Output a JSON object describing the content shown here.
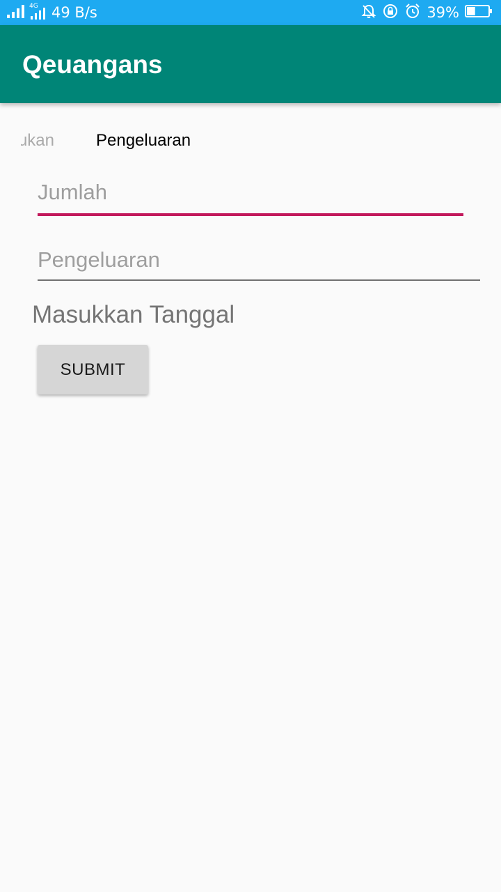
{
  "status_bar": {
    "network_type": "4G",
    "speed": "49 B/s",
    "battery_percent": "39%",
    "battery_level": 0.39,
    "icons": [
      "signal-icon",
      "signal-4g-icon",
      "mute-bell-icon",
      "rotation-lock-icon",
      "alarm-icon",
      "battery-icon"
    ]
  },
  "app_bar": {
    "title": "Qeuangans"
  },
  "tabs": [
    {
      "label": "Pemasukan",
      "visible_text": "ukan",
      "selected": false
    },
    {
      "label": "Pengeluaran",
      "selected": true
    }
  ],
  "form": {
    "jumlah": {
      "placeholder": "Jumlah",
      "value": ""
    },
    "pengeluaran": {
      "placeholder": "Pengeluaran",
      "value": ""
    },
    "date_label": "Masukkan Tanggal",
    "submit_label": "SUBMIT"
  },
  "colors": {
    "status_bar": "#1eaaf1",
    "app_bar": "#008577",
    "accent": "#c2185b",
    "background": "#fafafa"
  }
}
